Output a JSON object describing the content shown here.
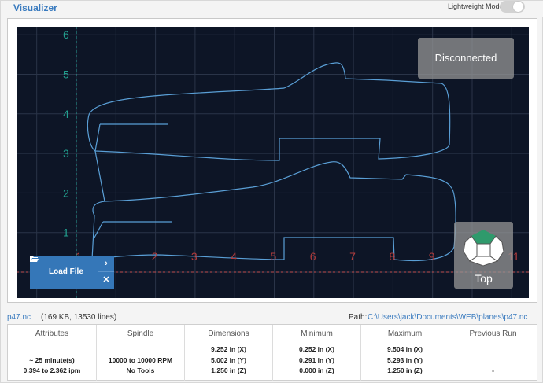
{
  "header": {
    "title": "Visualizer",
    "lightweight_label": "Lightweight Mode",
    "lightweight_on": false
  },
  "viz": {
    "status": "Disconnected",
    "load_file_label": "Load File",
    "view_label": "Top",
    "x_ticks": [
      "1",
      "2",
      "3",
      "4",
      "5",
      "6",
      "7",
      "8",
      "9",
      "10",
      "11"
    ],
    "y_ticks": [
      "1",
      "2",
      "3",
      "4",
      "5",
      "6"
    ],
    "colors": {
      "background": "#0d1526",
      "grid": "#2a3448",
      "toolpath": "#5a9fd6",
      "x_axis": "#c05050",
      "y_axis": "#2aa39a",
      "x_labels": "#b23b3b",
      "y_labels": "#22a08f"
    }
  },
  "file": {
    "name": "p47.nc",
    "meta": "(169 KB, 13530 lines)",
    "path_label": "Path:",
    "path": "C:\\Users\\jack\\Documents\\WEB\\planes\\p47.nc"
  },
  "stats": {
    "attributes": {
      "label": "Attributes",
      "lines": [
        "~ 25 minute(s)",
        "0.394 to 2.362 ipm"
      ]
    },
    "spindle": {
      "label": "Spindle",
      "lines": [
        "10000 to 10000 RPM",
        "No Tools"
      ]
    },
    "dimensions": {
      "label": "Dimensions",
      "lines": [
        "9.252 in (X)",
        "5.002 in (Y)",
        "1.250 in (Z)"
      ]
    },
    "minimum": {
      "label": "Minimum",
      "lines": [
        "0.252 in (X)",
        "0.291 in (Y)",
        "0.000 in (Z)"
      ]
    },
    "maximum": {
      "label": "Maximum",
      "lines": [
        "9.504 in (X)",
        "5.293 in (Y)",
        "1.250 in (Z)"
      ]
    },
    "previous_run": {
      "label": "Previous Run",
      "lines": [
        "-"
      ]
    }
  }
}
